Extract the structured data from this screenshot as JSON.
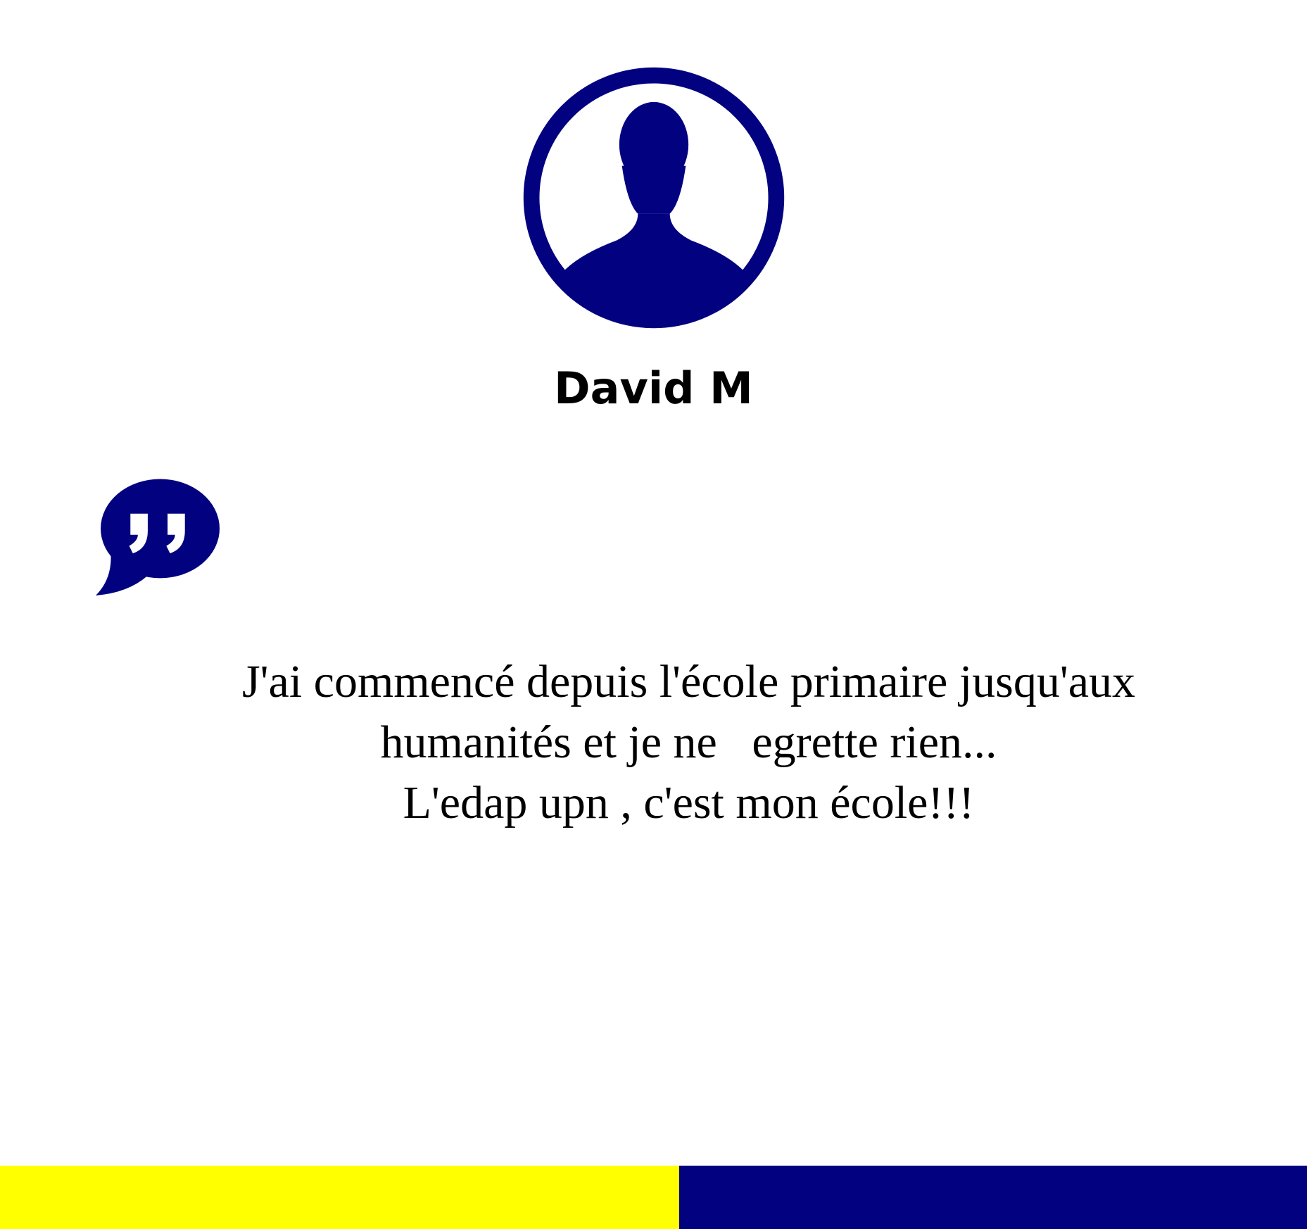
{
  "colors": {
    "accent_navy": "#020280",
    "accent_yellow": "#FFFF00",
    "text": "#000000",
    "background": "#FFFFFF"
  },
  "profile": {
    "avatar_icon": "user-silhouette-icon",
    "name": "David M"
  },
  "testimonial": {
    "quote_icon": "quote-bubble-icon",
    "lines": [
      "J'ai commencé depuis l'école primaire jusqu'aux",
      "humanités et je ne   egrette rien...",
      "L'edap upn , c'est mon école!!!"
    ]
  },
  "footer": {
    "segments": [
      "yellow",
      "navy"
    ]
  }
}
